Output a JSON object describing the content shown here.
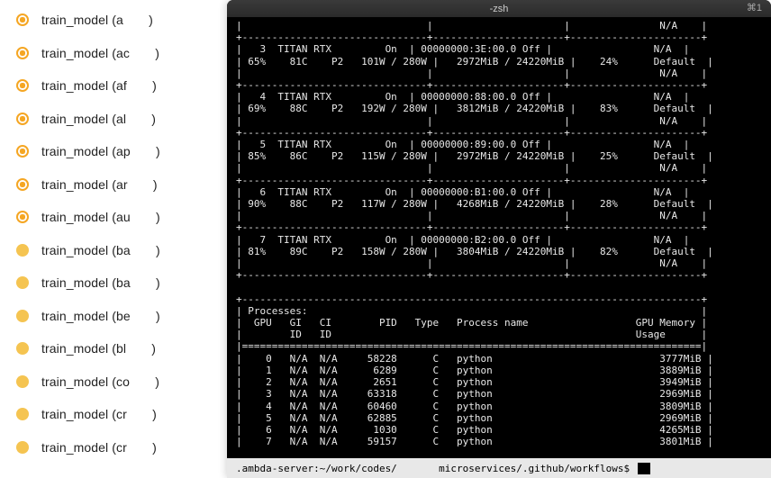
{
  "sidebar": {
    "items": [
      {
        "status": "running",
        "prefix": "train_model (a",
        "suffix": ")"
      },
      {
        "status": "running",
        "prefix": "train_model (ac",
        "suffix": ")"
      },
      {
        "status": "running",
        "prefix": "train_model (af",
        "suffix": ")"
      },
      {
        "status": "running",
        "prefix": "train_model (al",
        "suffix": ")"
      },
      {
        "status": "running",
        "prefix": "train_model (ap",
        "suffix": ")"
      },
      {
        "status": "running",
        "prefix": "train_model (ar",
        "suffix": ")"
      },
      {
        "status": "running",
        "prefix": "train_model (au",
        "suffix": ")"
      },
      {
        "status": "queued",
        "prefix": "train_model (ba",
        "suffix": ")"
      },
      {
        "status": "queued",
        "prefix": "train_model (ba",
        "suffix": ")"
      },
      {
        "status": "queued",
        "prefix": "train_model (be",
        "suffix": ")"
      },
      {
        "status": "queued",
        "prefix": "train_model (bl",
        "suffix": ")"
      },
      {
        "status": "queued",
        "prefix": "train_model (co",
        "suffix": ")"
      },
      {
        "status": "queued",
        "prefix": "train_model (cr",
        "suffix": ")"
      },
      {
        "status": "queued",
        "prefix": "train_model (cr",
        "suffix": ")"
      }
    ],
    "overflow_badge": ")"
  },
  "terminal": {
    "title": "-zsh",
    "right_badge": "⌘1",
    "gpu_sep": "+-------------------------------+----------------------+----------------------+",
    "gpu_header1": "|                               |                      |               N/A    |",
    "gpus": [
      {
        "idx": 3,
        "name": "TITAN RTX",
        "persist": "On",
        "bus": "00000000:3E:00.0 Off",
        "disp": "N/A",
        "fan": "65%",
        "temp": "81C",
        "perf": "P2",
        "pwr": "101W / 280W",
        "mem": "2972MiB / 24220MiB",
        "util": "24%",
        "comp": "Default",
        "mig": "N/A"
      },
      {
        "idx": 4,
        "name": "TITAN RTX",
        "persist": "On",
        "bus": "00000000:88:00.0 Off",
        "disp": "N/A",
        "fan": "69%",
        "temp": "88C",
        "perf": "P2",
        "pwr": "192W / 280W",
        "mem": "3812MiB / 24220MiB",
        "util": "83%",
        "comp": "Default",
        "mig": "N/A"
      },
      {
        "idx": 5,
        "name": "TITAN RTX",
        "persist": "On",
        "bus": "00000000:89:00.0 Off",
        "disp": "N/A",
        "fan": "85%",
        "temp": "86C",
        "perf": "P2",
        "pwr": "115W / 280W",
        "mem": "2972MiB / 24220MiB",
        "util": "25%",
        "comp": "Default",
        "mig": "N/A"
      },
      {
        "idx": 6,
        "name": "TITAN RTX",
        "persist": "On",
        "bus": "00000000:B1:00.0 Off",
        "disp": "N/A",
        "fan": "90%",
        "temp": "88C",
        "perf": "P2",
        "pwr": "117W / 280W",
        "mem": "4268MiB / 24220MiB",
        "util": "28%",
        "comp": "Default",
        "mig": "N/A"
      },
      {
        "idx": 7,
        "name": "TITAN RTX",
        "persist": "On",
        "bus": "00000000:B2:00.0 Off",
        "disp": "N/A",
        "fan": "81%",
        "temp": "89C",
        "perf": "P2",
        "pwr": "158W / 280W",
        "mem": "3804MiB / 24220MiB",
        "util": "82%",
        "comp": "Default",
        "mig": "N/A"
      }
    ],
    "proc_sep": "+-----------------------------------------------------------------------------+",
    "proc_title": "| Processes:                                                                  |",
    "proc_hdr1": "|  GPU   GI   CI        PID   Type   Process name                  GPU Memory |",
    "proc_hdr2": "|        ID   ID                                                   Usage      |",
    "proc_divider": "|=============================================================================|",
    "procs": [
      {
        "gpu": 0,
        "gi": "N/A",
        "ci": "N/A",
        "pid": 58228,
        "type": "C",
        "name": "python",
        "mem": "3777MiB"
      },
      {
        "gpu": 1,
        "gi": "N/A",
        "ci": "N/A",
        "pid": 6289,
        "type": "C",
        "name": "python",
        "mem": "3889MiB"
      },
      {
        "gpu": 2,
        "gi": "N/A",
        "ci": "N/A",
        "pid": 2651,
        "type": "C",
        "name": "python",
        "mem": "3949MiB"
      },
      {
        "gpu": 3,
        "gi": "N/A",
        "ci": "N/A",
        "pid": 63318,
        "type": "C",
        "name": "python",
        "mem": "2969MiB"
      },
      {
        "gpu": 4,
        "gi": "N/A",
        "ci": "N/A",
        "pid": 60460,
        "type": "C",
        "name": "python",
        "mem": "3809MiB"
      },
      {
        "gpu": 5,
        "gi": "N/A",
        "ci": "N/A",
        "pid": 62885,
        "type": "C",
        "name": "python",
        "mem": "2969MiB"
      },
      {
        "gpu": 6,
        "gi": "N/A",
        "ci": "N/A",
        "pid": 1030,
        "type": "C",
        "name": "python",
        "mem": "4265MiB"
      },
      {
        "gpu": 7,
        "gi": "N/A",
        "ci": "N/A",
        "pid": 59157,
        "type": "C",
        "name": "python",
        "mem": "3801MiB"
      }
    ],
    "prompt_left": ".ambda-server:~/work/codes/",
    "prompt_right": "microservices/.github/workflows$ "
  }
}
